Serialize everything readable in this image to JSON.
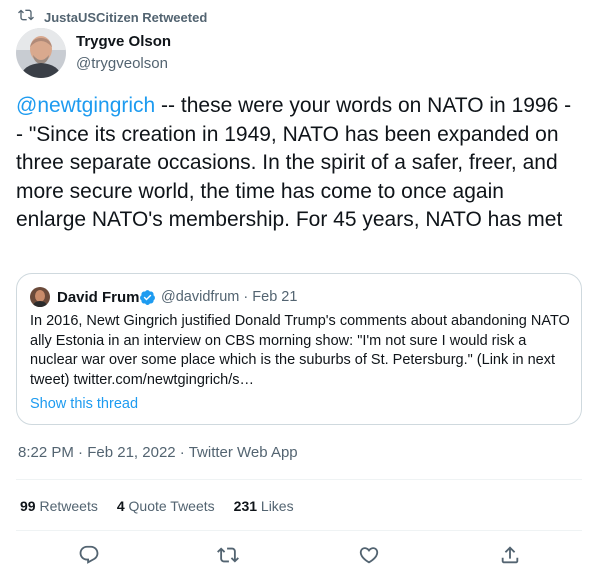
{
  "retweet": {
    "icon": "retweet-icon",
    "text": "JustaUSCitizen Retweeted"
  },
  "author": {
    "name": "Trygve Olson",
    "handle": "@trygveolson"
  },
  "tweet": {
    "mention": "@newtgingrich",
    "body": " -- these were your words on NATO in 1996 -- \"Since its creation in 1949, NATO has been expanded on three separate occasions. In the spirit of a safer, freer, and more secure world, the time has come to once again enlarge NATO's membership. For 45 years, NATO has met"
  },
  "quote": {
    "name": "David Frum",
    "verified_icon": "verified-badge-icon",
    "handle_date": "@davidfrum · Feb 21",
    "text": "In 2016, Newt Gingrich justified Donald Trump's comments about abandoning NATO ally Estonia in an interview on CBS morning show: \"I'm not sure I would risk a nuclear war over some place which is the suburbs of St. Petersburg.\" (Link in next tweet) twitter.com/newtgingrich/s…",
    "show_thread": "Show this thread"
  },
  "meta": {
    "time": "8:22 PM",
    "date": "Feb 21, 2022",
    "source": "Twitter Web App",
    "sep": " · "
  },
  "stats": {
    "retweets_count": "99",
    "retweets_label": "Retweets",
    "quotes_count": "4",
    "quotes_label": "Quote Tweets",
    "likes_count": "231",
    "likes_label": "Likes"
  },
  "actions": [
    "reply-icon",
    "retweet-icon",
    "like-icon",
    "share-icon"
  ],
  "colors": {
    "accent": "#1d9bf0",
    "text": "#0f1419",
    "muted": "#536471",
    "border": "#cfd9de"
  }
}
